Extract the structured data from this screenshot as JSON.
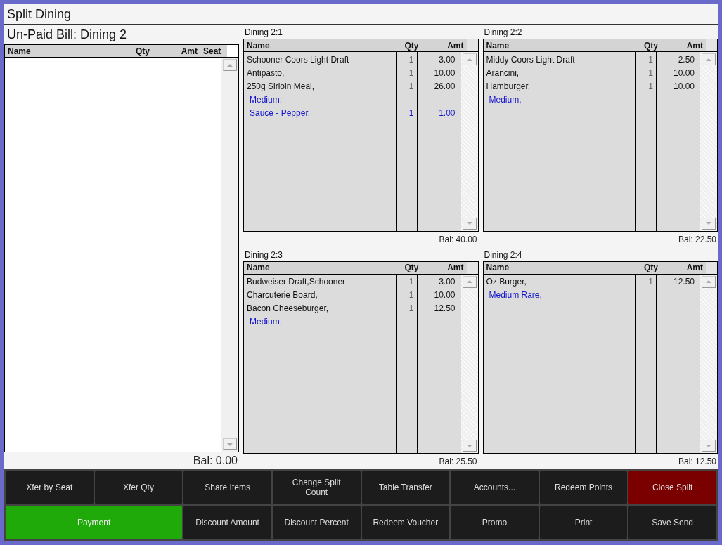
{
  "window": {
    "title": "Split Dining"
  },
  "unpaid": {
    "title": "Un-Paid Bill: Dining 2",
    "columns": [
      "Name",
      "Qty",
      "Amt",
      "Seat"
    ],
    "balance": "Bal: 0.00"
  },
  "splits": [
    {
      "title": "Dining 2:1",
      "columns": [
        "Name",
        "Qty",
        "Amt"
      ],
      "balance": "Bal: 40.00",
      "rows": [
        {
          "kind": "item",
          "name": "Schooner Coors Light Draft",
          "qty": "1",
          "amt": "3.00"
        },
        {
          "kind": "item",
          "name": "Antipasto,",
          "qty": "1",
          "amt": "10.00"
        },
        {
          "kind": "item",
          "name": "250g Sirloin Meal,",
          "qty": "1",
          "amt": "26.00"
        },
        {
          "kind": "modifier",
          "name": "Medium,"
        },
        {
          "kind": "modifier",
          "name": "Sauce - Pepper,",
          "qty": "1",
          "amt": "1.00"
        }
      ]
    },
    {
      "title": "Dining 2:2",
      "columns": [
        "Name",
        "Qty",
        "Amt"
      ],
      "balance": "Bal: 22.50",
      "rows": [
        {
          "kind": "item",
          "name": "Middy Coors Light Draft",
          "qty": "1",
          "amt": "2.50"
        },
        {
          "kind": "item",
          "name": "Arancini,",
          "qty": "1",
          "amt": "10.00"
        },
        {
          "kind": "item",
          "name": "Hamburger,",
          "qty": "1",
          "amt": "10.00"
        },
        {
          "kind": "modifier",
          "name": "Medium,"
        }
      ]
    },
    {
      "title": "Dining 2:3",
      "columns": [
        "Name",
        "Qty",
        "Amt"
      ],
      "balance": "Bal: 25.50",
      "rows": [
        {
          "kind": "item",
          "name": "Budweiser Draft,Schooner",
          "qty": "1",
          "amt": "3.00"
        },
        {
          "kind": "item",
          "name": "Charcuterie Board,",
          "qty": "1",
          "amt": "10.00"
        },
        {
          "kind": "item",
          "name": "Bacon Cheeseburger,",
          "qty": "1",
          "amt": "12.50"
        },
        {
          "kind": "modifier",
          "name": "Medium,"
        }
      ]
    },
    {
      "title": "Dining 2:4",
      "columns": [
        "Name",
        "Qty",
        "Amt"
      ],
      "balance": "Bal: 12.50",
      "rows": [
        {
          "kind": "item",
          "name": "Oz Burger,",
          "qty": "1",
          "amt": "12.50"
        },
        {
          "kind": "modifier",
          "name": "Medium Rare,"
        }
      ]
    }
  ],
  "buttons": [
    {
      "label": "Xfer by Seat",
      "kind": "normal",
      "wide": false
    },
    {
      "label": "Xfer Qty",
      "kind": "normal",
      "wide": false
    },
    {
      "label": "Share Items",
      "kind": "normal",
      "wide": false
    },
    {
      "label": "Change Split Count",
      "kind": "normal",
      "wide": false
    },
    {
      "label": "Table Transfer",
      "kind": "normal",
      "wide": false
    },
    {
      "label": "Accounts...",
      "kind": "normal",
      "wide": false
    },
    {
      "label": "Redeem Points",
      "kind": "normal",
      "wide": false
    },
    {
      "label": "Close Split",
      "kind": "danger",
      "wide": false
    },
    {
      "label": "Payment",
      "kind": "primary",
      "wide": true
    },
    {
      "label": "Discount Amount",
      "kind": "normal",
      "wide": false
    },
    {
      "label": "Discount Percent",
      "kind": "normal",
      "wide": false
    },
    {
      "label": "Redeem Voucher",
      "kind": "normal",
      "wide": false
    },
    {
      "label": "Promo",
      "kind": "normal",
      "wide": false
    },
    {
      "label": "Print",
      "kind": "normal",
      "wide": false
    },
    {
      "label": "Save Send",
      "kind": "normal",
      "wide": false
    }
  ]
}
